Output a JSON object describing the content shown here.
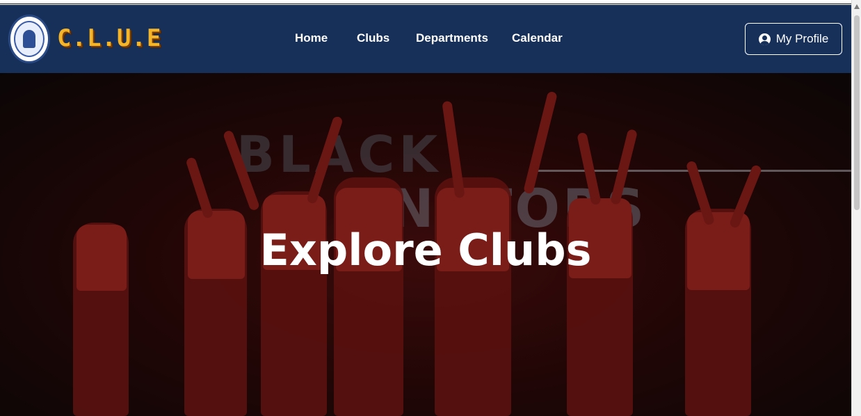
{
  "brand": {
    "name": "C.L.U.E",
    "logo_icon": "university-seal-icon"
  },
  "nav": {
    "items": [
      {
        "label": "Home"
      },
      {
        "label": "Clubs"
      },
      {
        "label": "Departments"
      },
      {
        "label": "Calendar"
      }
    ]
  },
  "profile": {
    "label": "My Profile",
    "icon": "user-circle-icon"
  },
  "hero": {
    "title": "Explore Clubs",
    "background_text_1": "BLACK",
    "background_text_2": "NATORS"
  },
  "colors": {
    "navbar": "#17305a",
    "brand_text": "#f4b52b",
    "hero_overlay": "#220606",
    "text": "#ffffff"
  }
}
